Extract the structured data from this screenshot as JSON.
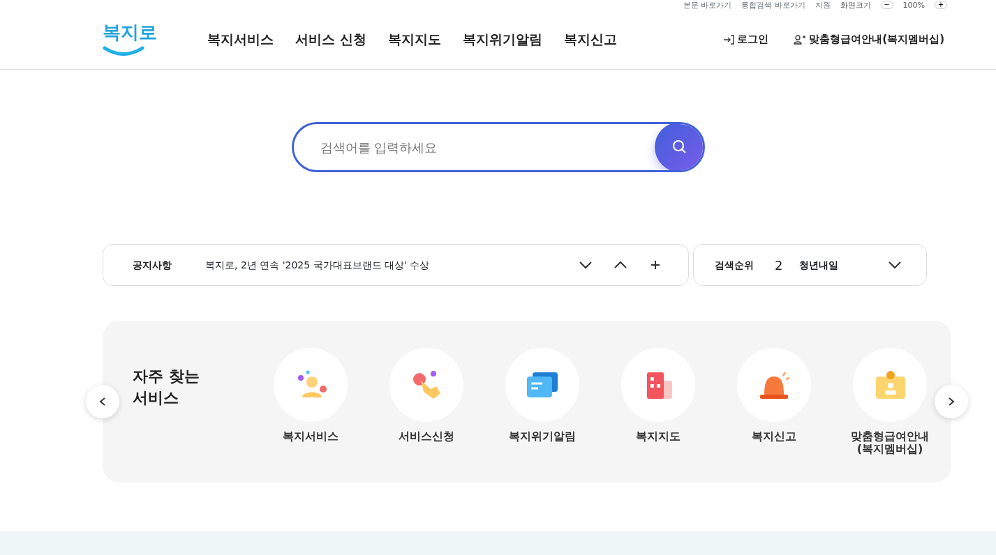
{
  "utility_bar": {
    "links": [
      "본문 바로가기",
      "통합검색 바로가기",
      "지원"
    ],
    "zoom_label": "화면크기",
    "zoom_minus": "−",
    "zoom_value": "100%",
    "zoom_plus": "+"
  },
  "logo": "복지로",
  "nav": [
    "복지서비스",
    "서비스 신청",
    "복지지도",
    "복지위기알림",
    "복지신고"
  ],
  "account": [
    {
      "kind": "login",
      "label": "로그인"
    },
    {
      "kind": "member",
      "label": "맞춤형급여안내(복지멤버십)"
    }
  ],
  "search": {
    "placeholder": "검색어를 입력하세요"
  },
  "notice": {
    "label": "공지사항",
    "text": "복지로, 2년 연속 '2025 국가대표브랜드 대상' 수상"
  },
  "ranking": {
    "label": "검색순위",
    "rank": "2",
    "keyword": "청년내일"
  },
  "services": {
    "title": "자주 찾는\n서비스",
    "items": [
      {
        "kind": "person",
        "label": "복지서비스"
      },
      {
        "kind": "hand",
        "label": "서비스신청"
      },
      {
        "kind": "message",
        "label": "복지위기알림"
      },
      {
        "kind": "building",
        "label": "복지지도"
      },
      {
        "kind": "siren",
        "label": "복지신고"
      },
      {
        "kind": "badge",
        "label": "맞춤형급여안내\n(복지멤버십)"
      }
    ]
  }
}
